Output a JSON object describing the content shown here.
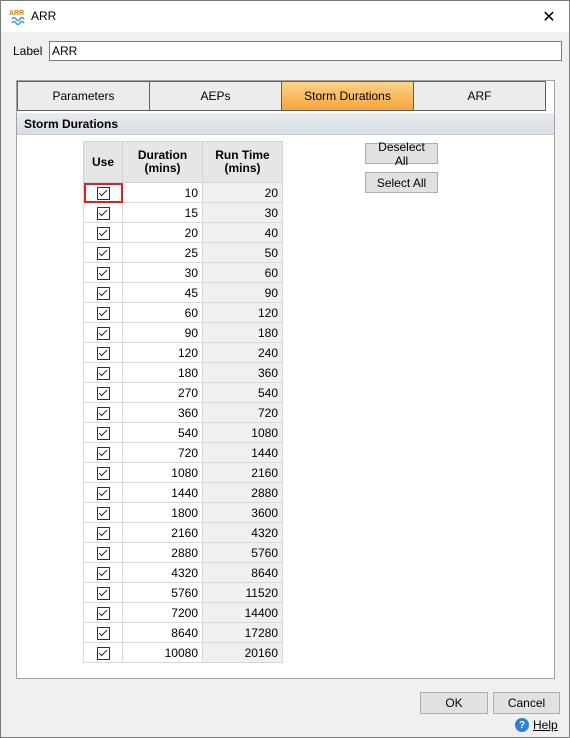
{
  "window": {
    "title": "ARR",
    "app_icon_text": "ARR",
    "close_glyph": "✕"
  },
  "label": {
    "text": "Label",
    "value": "ARR"
  },
  "tabs": [
    {
      "label": "Parameters",
      "active": false
    },
    {
      "label": "AEPs",
      "active": false
    },
    {
      "label": "Storm Durations",
      "active": true
    },
    {
      "label": "ARF",
      "active": false
    }
  ],
  "section_title": "Storm Durations",
  "grid": {
    "headers": {
      "use": "Use",
      "duration": [
        "Duration",
        "(mins)"
      ],
      "run_time": [
        "Run Time",
        "(mins)"
      ]
    },
    "rows": [
      {
        "checked": true,
        "duration": "10",
        "run_time": "20"
      },
      {
        "checked": true,
        "duration": "15",
        "run_time": "30"
      },
      {
        "checked": true,
        "duration": "20",
        "run_time": "40"
      },
      {
        "checked": true,
        "duration": "25",
        "run_time": "50"
      },
      {
        "checked": true,
        "duration": "30",
        "run_time": "60"
      },
      {
        "checked": true,
        "duration": "45",
        "run_time": "90"
      },
      {
        "checked": true,
        "duration": "60",
        "run_time": "120"
      },
      {
        "checked": true,
        "duration": "90",
        "run_time": "180"
      },
      {
        "checked": true,
        "duration": "120",
        "run_time": "240"
      },
      {
        "checked": true,
        "duration": "180",
        "run_time": "360"
      },
      {
        "checked": true,
        "duration": "270",
        "run_time": "540"
      },
      {
        "checked": true,
        "duration": "360",
        "run_time": "720"
      },
      {
        "checked": true,
        "duration": "540",
        "run_time": "1080"
      },
      {
        "checked": true,
        "duration": "720",
        "run_time": "1440"
      },
      {
        "checked": true,
        "duration": "1080",
        "run_time": "2160"
      },
      {
        "checked": true,
        "duration": "1440",
        "run_time": "2880"
      },
      {
        "checked": true,
        "duration": "1800",
        "run_time": "3600"
      },
      {
        "checked": true,
        "duration": "2160",
        "run_time": "4320"
      },
      {
        "checked": true,
        "duration": "2880",
        "run_time": "5760"
      },
      {
        "checked": true,
        "duration": "4320",
        "run_time": "8640"
      },
      {
        "checked": true,
        "duration": "5760",
        "run_time": "11520"
      },
      {
        "checked": true,
        "duration": "7200",
        "run_time": "14400"
      },
      {
        "checked": true,
        "duration": "8640",
        "run_time": "17280"
      },
      {
        "checked": true,
        "duration": "10080",
        "run_time": "20160"
      }
    ]
  },
  "buttons": {
    "deselect_all": "Deselect All",
    "select_all": "Select All",
    "ok": "OK",
    "cancel": "Cancel",
    "help": "Help"
  },
  "colors": {
    "active_tab": "#f6a53a",
    "focus_outline": "#e02020",
    "help_icon": "#2f7fd6"
  }
}
